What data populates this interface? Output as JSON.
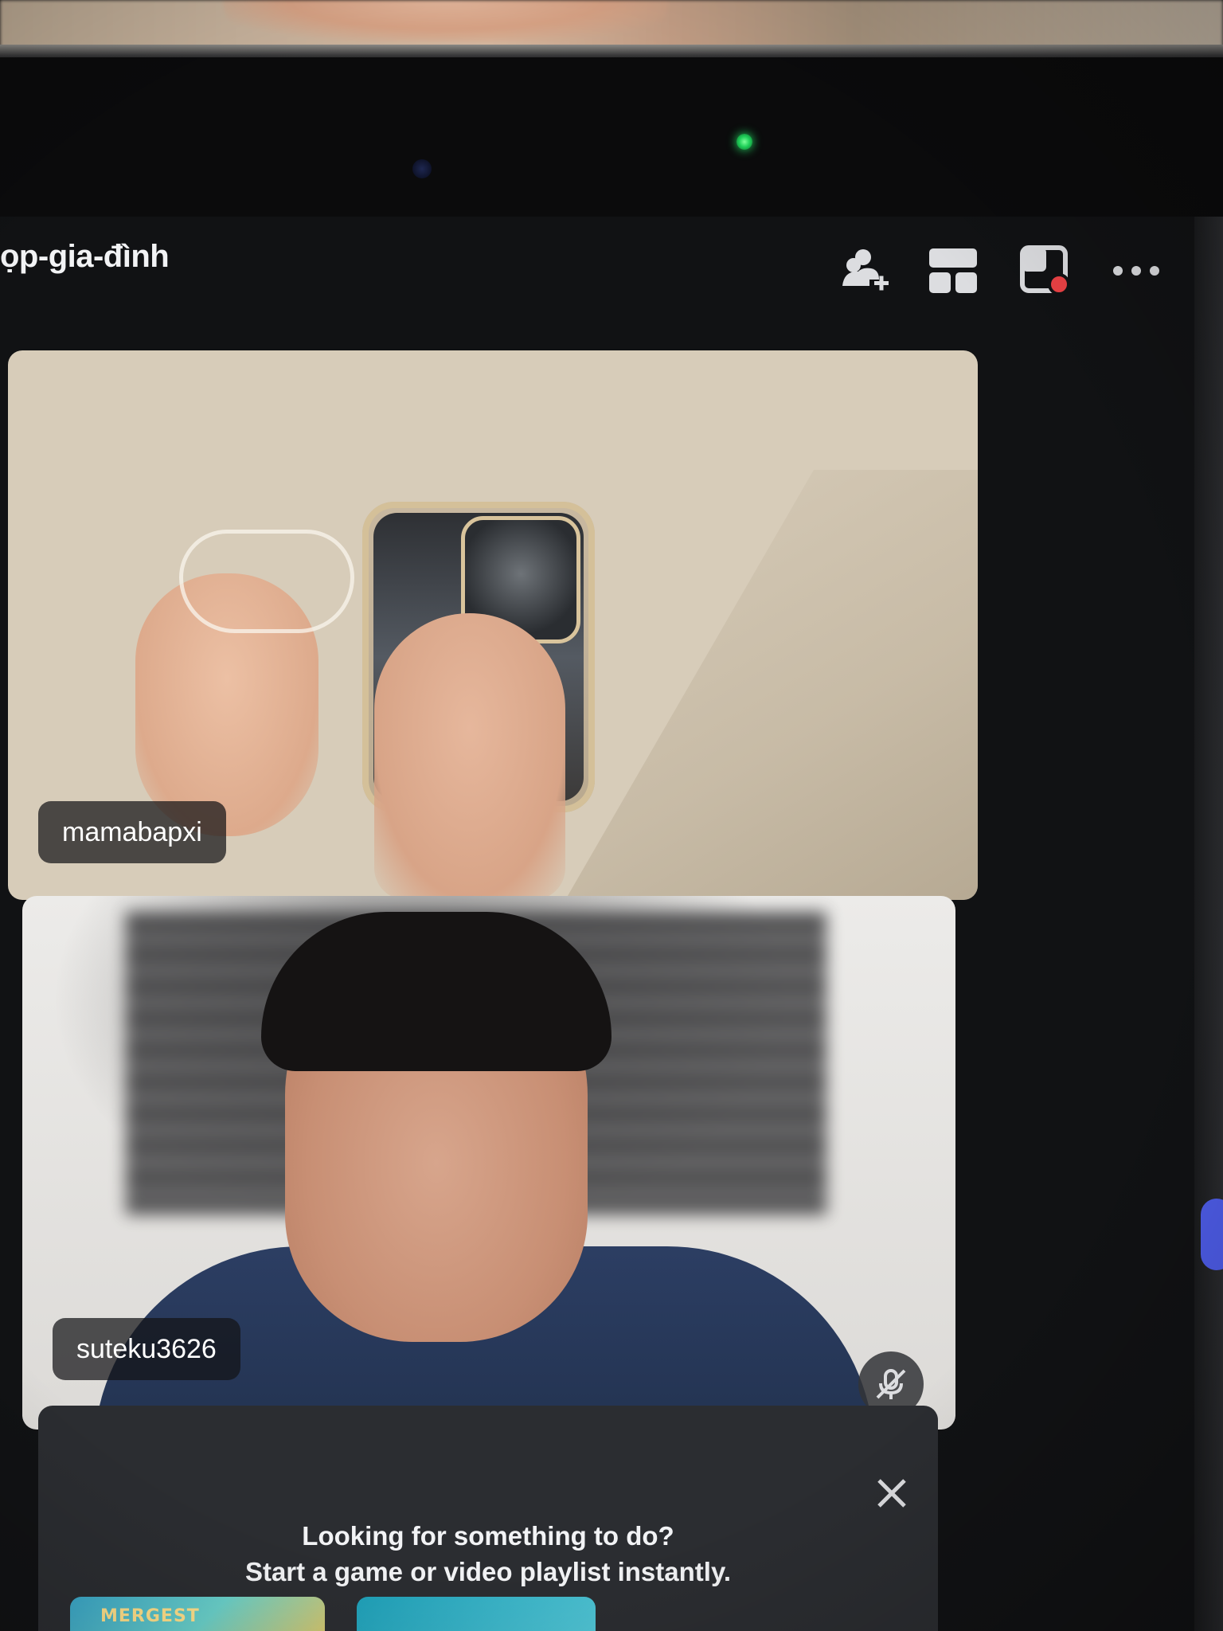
{
  "header": {
    "channel_title": "ọp-gia-đình",
    "icons": {
      "invite": "add-user-icon",
      "grid": "grid-layout-icon",
      "popout": "popout-window-icon",
      "more": "more-options-icon"
    }
  },
  "participants": [
    {
      "name": "mamabapxi",
      "muted": false
    },
    {
      "name": "suteku3626",
      "muted": true
    }
  ],
  "activity_card": {
    "line1": "Looking for something to do?",
    "line2": "Start a game or video playlist instantly.",
    "thumb_label": "MERGEST"
  },
  "colors": {
    "background": "#111214",
    "card": "#2b2d31",
    "camera_led": "#20d15a",
    "popout_badge": "#ed4245",
    "accent": "#4e5dea"
  }
}
